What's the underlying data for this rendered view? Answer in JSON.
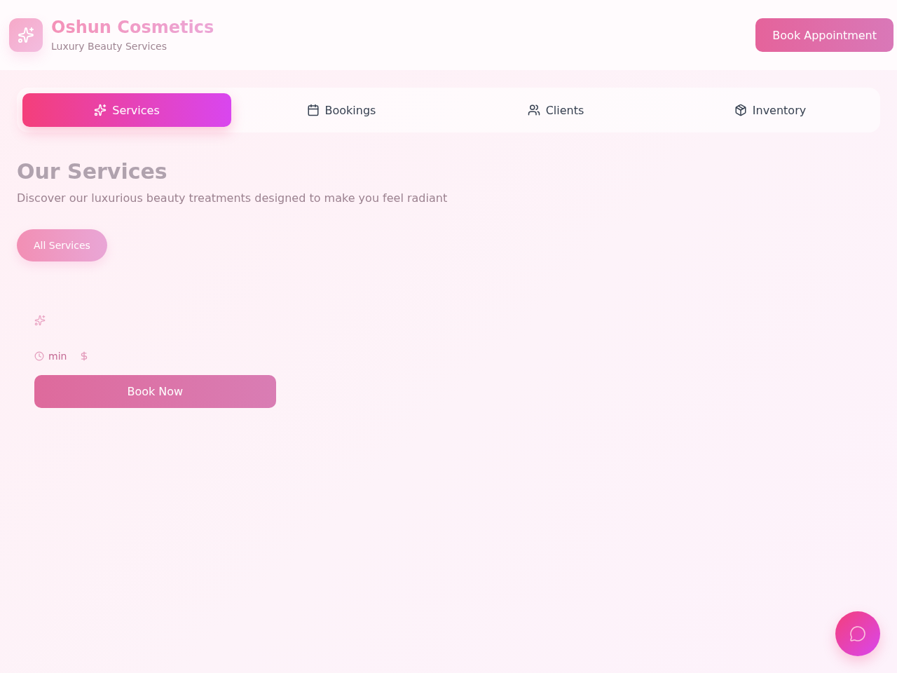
{
  "header": {
    "brand": "Oshun Cosmetics",
    "tagline": "Luxury Beauty Services",
    "action": "Book Appointment"
  },
  "tabs": [
    {
      "label": "Services",
      "selected": true
    },
    {
      "label": "Bookings",
      "selected": false
    },
    {
      "label": "Clients",
      "selected": false
    },
    {
      "label": "Inventory",
      "selected": false
    }
  ],
  "section": {
    "title": "Our Services",
    "subtitle": "Discover our luxurious beauty treatments designed to make you feel radiant",
    "filters": [
      {
        "label": "All Services",
        "selected": true
      }
    ]
  },
  "services": [
    {
      "duration": "min",
      "action": "Book Now"
    }
  ]
}
